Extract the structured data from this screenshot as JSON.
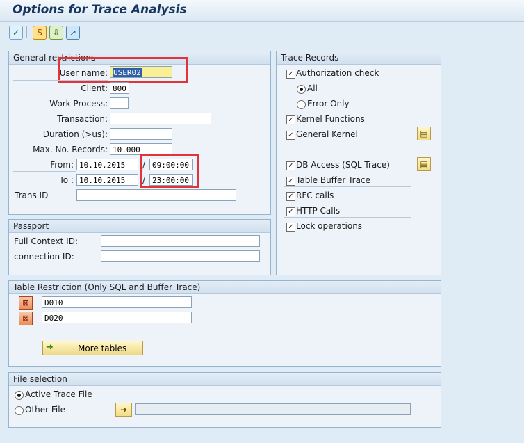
{
  "window": {
    "title": "Options for Trace Analysis"
  },
  "toolbar": {
    "icons": [
      "execute-icon",
      "settings-icon",
      "load-icon",
      "save-icon"
    ]
  },
  "general_restrictions": {
    "label": "General restrictions",
    "user_name_label": "User name:",
    "user_name_value": "USER02",
    "client_label": "Client:",
    "client_value": "800",
    "work_process_label": "Work Process:",
    "work_process_value": "",
    "transaction_label": "Transaction:",
    "transaction_value": "",
    "duration_label": "Duration (>us):",
    "duration_value": "",
    "max_records_label": "Max. No. Records:",
    "max_records_value": "10.000",
    "from_label": "From:",
    "from_date": "10.10.2015",
    "from_sep": "/",
    "from_time": "09:00:00",
    "to_label": "To :",
    "to_date": "10.10.2015",
    "to_sep": "/",
    "to_time": "23:00:00",
    "trans_id_label": "Trans ID",
    "trans_id_value": ""
  },
  "trace_records": {
    "label": "Trace Records",
    "authorization_check": "Authorization check",
    "all": "All",
    "error_only": "Error Only",
    "kernel_functions": "Kernel Functions",
    "general_kernel": "General Kernel",
    "db_access": "DB Access (SQL Trace)",
    "table_buffer_trace": "Table Buffer Trace",
    "rfc_calls": "RFC calls",
    "http_calls": "HTTP Calls",
    "lock_operations": "Lock operations"
  },
  "passport": {
    "label": "Passport",
    "full_context_label": "Full Context ID:",
    "full_context_value": "",
    "connection_label": "connection ID:",
    "connection_value": ""
  },
  "table_restriction": {
    "label": "Table Restriction (Only SQL and Buffer Trace)",
    "rows": [
      "D010",
      "D020"
    ],
    "more_tables": "More tables"
  },
  "file_selection": {
    "label": "File selection",
    "active_trace_file": "Active Trace File",
    "other_file": "Other File",
    "other_file_value": ""
  }
}
